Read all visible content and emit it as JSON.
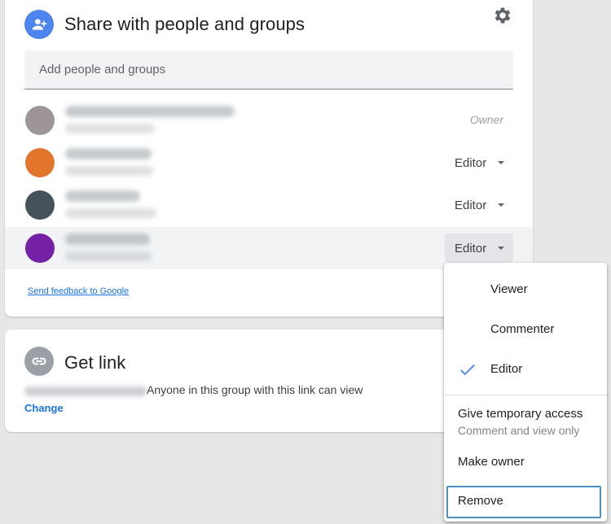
{
  "share": {
    "title": "Share with people and groups",
    "add_placeholder": "Add people and groups",
    "people": [
      {
        "role": "Owner",
        "avatar_color": "#9e9597"
      },
      {
        "role": "Editor",
        "avatar_color": "#e1752c"
      },
      {
        "role": "Editor",
        "avatar_color": "#45525c"
      },
      {
        "role": "Editor",
        "avatar_color": "#7421a6"
      }
    ],
    "feedback_link": "Send feedback to Google"
  },
  "link": {
    "title": "Get link",
    "description": "Anyone in this group with this link can view",
    "change_label": "Change"
  },
  "role_menu": {
    "viewer": "Viewer",
    "commenter": "Commenter",
    "editor": "Editor",
    "selected": "Editor",
    "temporary_access": "Give temporary access",
    "temporary_access_sub": "Comment and view only",
    "make_owner": "Make owner",
    "remove": "Remove"
  },
  "colors": {
    "accent_blue": "#4c84f0",
    "link_blue": "#1a73e8",
    "link_icon_gray": "#9aa0a6",
    "focus_outline": "#4a90c2"
  },
  "icons": {
    "share_header": "person-add-icon",
    "settings": "gear-icon",
    "link_header": "link-icon",
    "menu_selected": "check-icon",
    "role_dropdown": "caret-down-icon"
  }
}
